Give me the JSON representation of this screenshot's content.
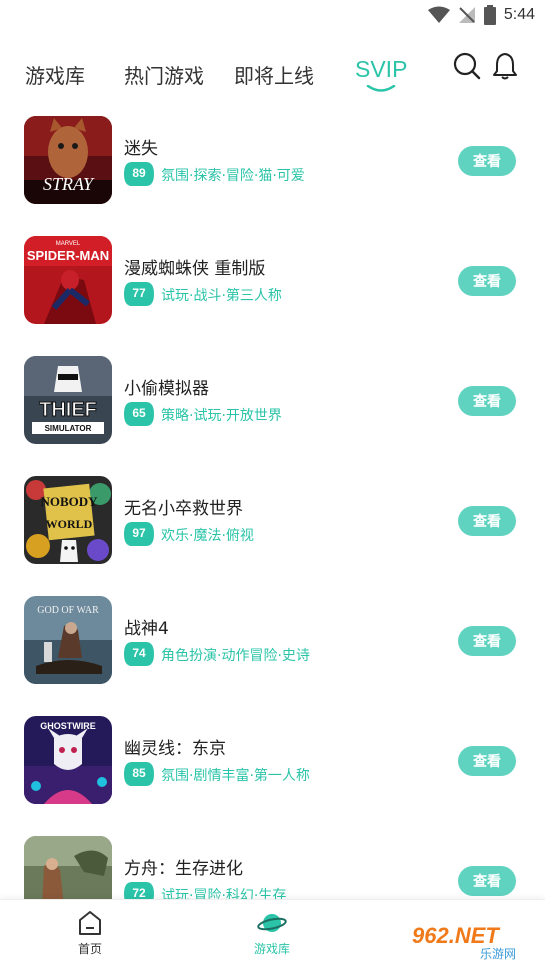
{
  "status_bar": {
    "time": "5:44"
  },
  "top_tabs": [
    {
      "label": "游戏库",
      "active": false
    },
    {
      "label": "热门游戏",
      "active": false
    },
    {
      "label": "即将上线",
      "active": false
    },
    {
      "label": "SVIP",
      "active": true
    }
  ],
  "accent_color": "#2bc4a8",
  "games": [
    {
      "title": "迷失",
      "score": "89",
      "tags": "氛围·探索·冒险·猫·可爱",
      "button": "查看",
      "cover_text": "STRAY"
    },
    {
      "title": "漫威蜘蛛侠 重制版",
      "score": "77",
      "tags": "试玩·战斗·第三人称",
      "button": "查看",
      "cover_text": "SPIDER-MAN",
      "cover_subtext": "MARVEL"
    },
    {
      "title": "小偷模拟器",
      "score": "65",
      "tags": "策略·试玩·开放世界",
      "button": "查看",
      "cover_text": "THIEF",
      "cover_subtext": "SIMULATOR"
    },
    {
      "title": "无名小卒救世界",
      "score": "97",
      "tags": "欢乐·魔法·俯视",
      "button": "查看",
      "cover_text": "NOBODY",
      "cover_subtext": "WORLD"
    },
    {
      "title": "战神4",
      "score": "74",
      "tags": "角色扮演·动作冒险·史诗",
      "button": "查看",
      "cover_text": "GOD OF WAR"
    },
    {
      "title": "幽灵线：东京",
      "score": "85",
      "tags": "氛围·剧情丰富·第一人称",
      "button": "查看",
      "cover_text": "GHOSTWIRE"
    },
    {
      "title": "方舟：生存进化",
      "score": "72",
      "tags": "试玩·冒险·科幻·生存",
      "button": "查看",
      "cover_text": ""
    }
  ],
  "bottom_nav": [
    {
      "label": "首页",
      "icon": "home-icon",
      "active": false
    },
    {
      "label": "游戏库",
      "icon": "planet-icon",
      "active": true
    }
  ],
  "watermark": {
    "text": "962.NET",
    "subtext": "乐游网"
  }
}
